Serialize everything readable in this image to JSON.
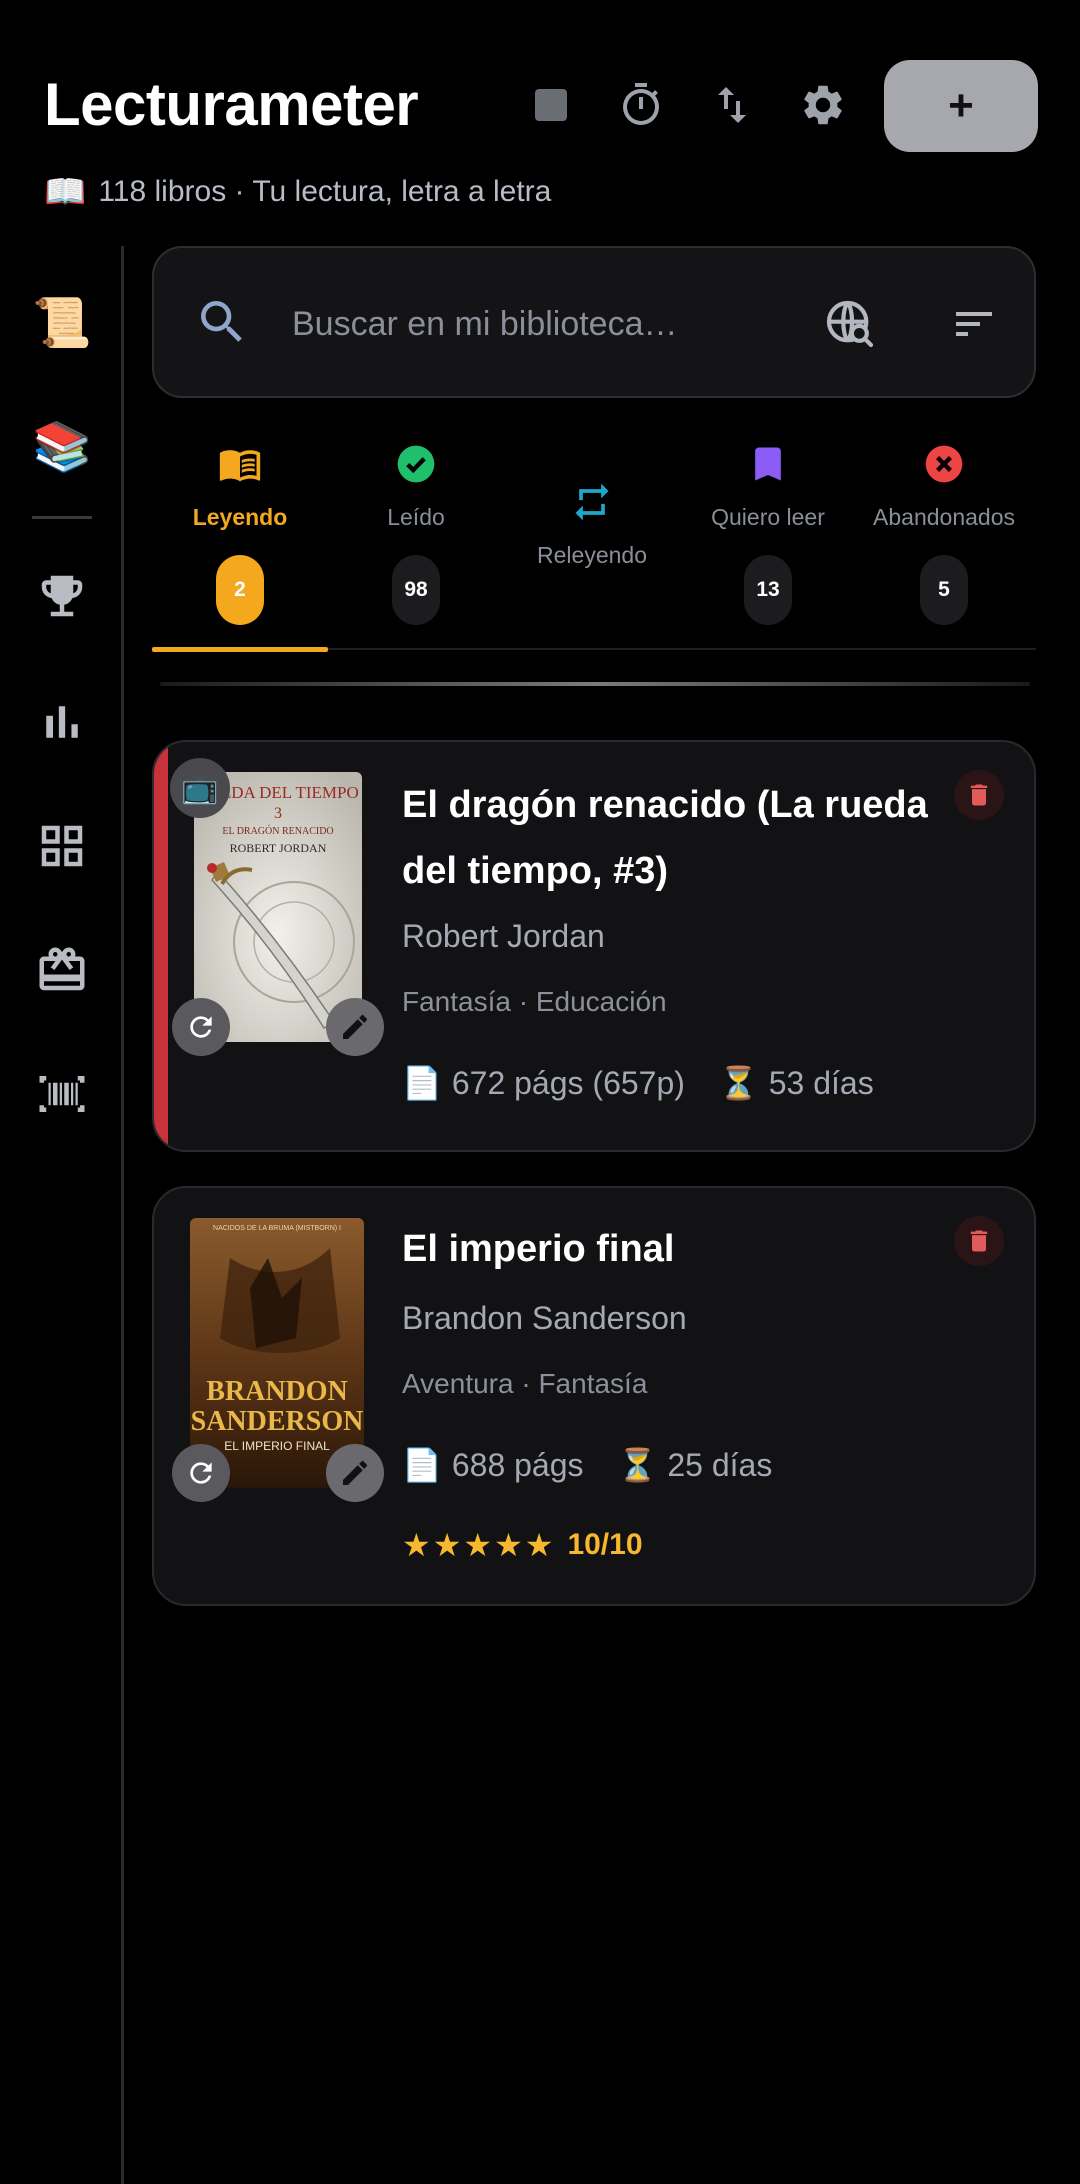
{
  "app": {
    "title": "Lecturameter",
    "subtitle_emoji": "📖",
    "subtitle": "118 libros · Tu lectura, letra a letra",
    "add_label": "+"
  },
  "header_icons": [
    "stop-icon",
    "timer-icon",
    "swap-vertical-icon",
    "gear-icon"
  ],
  "sidebar": {
    "items": [
      {
        "name": "scroll",
        "emoji": "📜"
      },
      {
        "name": "books",
        "emoji": "📚"
      },
      {
        "name": "trophy"
      },
      {
        "name": "stats"
      },
      {
        "name": "grid"
      },
      {
        "name": "gift"
      },
      {
        "name": "barcode"
      }
    ]
  },
  "search": {
    "placeholder": "Buscar en mi biblioteca…"
  },
  "tabs": [
    {
      "label": "Leyendo",
      "count": "2",
      "icon": "open-book-icon",
      "color": "#f3a81e",
      "active": true
    },
    {
      "label": "Leído",
      "count": "98",
      "icon": "check-circle-icon",
      "color": "#1fbf6b"
    },
    {
      "label": "Releyendo",
      "count": "",
      "icon": "repeat-icon",
      "color": "#1fa7c9"
    },
    {
      "label": "Quiero leer",
      "count": "13",
      "icon": "bookmark-icon",
      "color": "#8b5cf6"
    },
    {
      "label": "Abandonados",
      "count": "5",
      "icon": "x-circle-icon",
      "color": "#ef4444"
    }
  ],
  "books": [
    {
      "title": "El dragón renacido (La rueda del tiempo, #3)",
      "author": "Robert Jordan",
      "genres": "Fantasía · Educación",
      "pages_emoji": "📄",
      "pages": "672 págs (657p)",
      "days_emoji": "⏳",
      "days": "53 días",
      "tv_emoji": "📺",
      "cover": {
        "line1": "RUEDA DEL TIEMPO",
        "line2": "3",
        "line3": "EL DRAGÓN RENACIDO",
        "line4": "ROBERT JORDAN"
      },
      "accent": "#c8333b"
    },
    {
      "title": "El imperio final",
      "author": "Brandon Sanderson",
      "genres": "Aventura · Fantasía",
      "pages_emoji": "📄",
      "pages": "688 págs",
      "days_emoji": "⏳",
      "days": "25 días",
      "stars": "★★★★★",
      "rating": "10/10",
      "cover": {
        "line1": "NACIDOS DE LA BRUMA (MISTBORN) I",
        "line2": "BRANDON",
        "line3": "SANDERSON",
        "line4": "EL IMPERIO FINAL"
      }
    }
  ]
}
